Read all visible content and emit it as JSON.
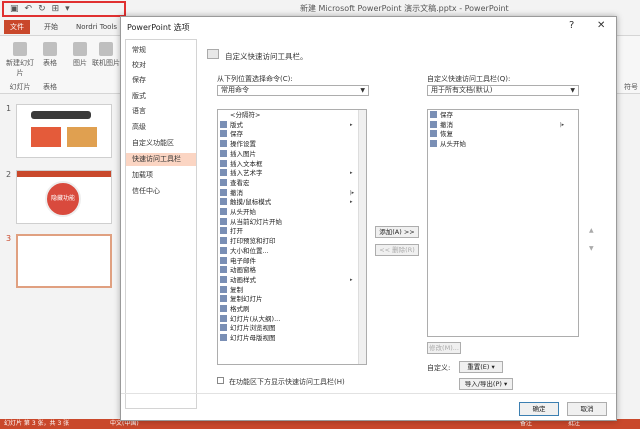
{
  "window": {
    "title": "新建 Microsoft PowerPoint 演示文稿.pptx - PowerPoint",
    "qat_icons": [
      "save-icon",
      "undo-icon",
      "redo-icon",
      "slideshow-icon",
      "customize-icon"
    ]
  },
  "ribbon": {
    "tabs": [
      "文件",
      "开始",
      "Nordri Tools"
    ],
    "buttons": [
      "新建幻灯片",
      "表格",
      "图片",
      "联机图片"
    ],
    "groups": [
      "幻灯片",
      "表格"
    ],
    "right_label": "符号"
  },
  "thumbnails": {
    "numbers": [
      "1",
      "2",
      "3"
    ],
    "slide2_text": "隐藏功能"
  },
  "status": {
    "text": "幻灯片 第 3 张，共 3 张",
    "lang": "中文(中国)",
    "notes": "备注",
    "comments": "批注"
  },
  "dialog": {
    "title": "PowerPoint 选项",
    "help": "?",
    "close": "✕",
    "nav": [
      "常规",
      "校对",
      "保存",
      "版式",
      "语言",
      "高级",
      "自定义功能区",
      "快速访问工具栏",
      "加载项",
      "信任中心"
    ],
    "nav_selected_index": 7,
    "heading": "自定义快速访问工具栏。",
    "choose_label": "从下列位置选择命令(C):",
    "choose_value": "常用命令",
    "customize_label": "自定义快速访问工具栏(Q):",
    "customize_value": "用于所有文档(默认)",
    "commands": [
      {
        "label": "<分隔符>",
        "sub": ""
      },
      {
        "label": "版式",
        "sub": "▸"
      },
      {
        "label": "保存",
        "sub": ""
      },
      {
        "label": "操作设置",
        "sub": ""
      },
      {
        "label": "插入图片",
        "sub": ""
      },
      {
        "label": "插入文本框",
        "sub": ""
      },
      {
        "label": "插入艺术字",
        "sub": "▸"
      },
      {
        "label": "查看宏",
        "sub": ""
      },
      {
        "label": "撤消",
        "sub": "|▸"
      },
      {
        "label": "触摸/鼠标模式",
        "sub": "▸"
      },
      {
        "label": "从头开始",
        "sub": ""
      },
      {
        "label": "从当前幻灯片开始",
        "sub": ""
      },
      {
        "label": "打开",
        "sub": ""
      },
      {
        "label": "打印预览和打印",
        "sub": ""
      },
      {
        "label": "大小和位置...",
        "sub": ""
      },
      {
        "label": "电子邮件",
        "sub": ""
      },
      {
        "label": "动画窗格",
        "sub": ""
      },
      {
        "label": "动画样式",
        "sub": "▸"
      },
      {
        "label": "复制",
        "sub": ""
      },
      {
        "label": "复制幻灯片",
        "sub": ""
      },
      {
        "label": "格式刷",
        "sub": ""
      },
      {
        "label": "幻灯片(从大纲)...",
        "sub": ""
      },
      {
        "label": "幻灯片浏览视图",
        "sub": ""
      },
      {
        "label": "幻灯片母版视图",
        "sub": ""
      }
    ],
    "qat_items": [
      {
        "label": "保存",
        "sub": ""
      },
      {
        "label": "撤消",
        "sub": "|▸"
      },
      {
        "label": "恢复",
        "sub": ""
      },
      {
        "label": "从头开始",
        "sub": ""
      }
    ],
    "add_button": "添加(A) >>",
    "remove_button": "<< 删除(R)",
    "modify_button": "修改(M)...",
    "customize_label2": "自定义:",
    "reset_button": "重置(E) ▾",
    "import_export_button": "导入/导出(P) ▾",
    "checkbox_label": "在功能区下方显示快速访问工具栏(H)",
    "ok": "确定",
    "cancel": "取消",
    "colors": {
      "accent": "#c9482b",
      "nav_selected": "#fbd5c3"
    }
  }
}
